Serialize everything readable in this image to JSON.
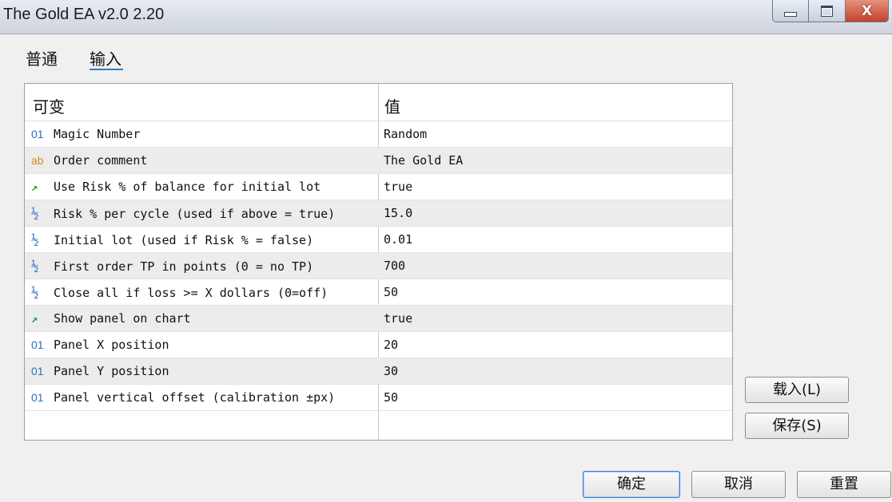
{
  "window": {
    "title": "The Gold EA v2.0 2.20",
    "controls": {
      "minimize": "_",
      "maximize": "□",
      "close": "X"
    }
  },
  "tabs": [
    {
      "label": "普通"
    },
    {
      "label": "输入",
      "active": true
    }
  ],
  "table": {
    "headers": {
      "name": "可变",
      "value": "值"
    },
    "rows": [
      {
        "icon": "01",
        "icon_type": "int-icon",
        "name": "Magic Number",
        "value": "Random"
      },
      {
        "icon": "ab",
        "icon_type": "string-icon",
        "name": "Order comment",
        "value": "The Gold EA"
      },
      {
        "icon": "↗",
        "icon_type": "bool-icon",
        "name": "Use Risk % of balance for initial lot",
        "value": "true"
      },
      {
        "icon": "½",
        "icon_type": "double-icon",
        "name": "Risk % per cycle (used if above = true)",
        "value": "15.0"
      },
      {
        "icon": "½",
        "icon_type": "double-icon",
        "name": "Initial lot (used if Risk % = false)",
        "value": "0.01"
      },
      {
        "icon": "½",
        "icon_type": "double-icon",
        "name": "First order TP in points (0 = no TP)",
        "value": "700"
      },
      {
        "icon": "½",
        "icon_type": "double-icon",
        "name": "Close all if loss >= X dollars (0=off)",
        "value": "50"
      },
      {
        "icon": "↗",
        "icon_type": "bool-icon",
        "name": "Show panel on chart",
        "value": "true"
      },
      {
        "icon": "01",
        "icon_type": "int-icon",
        "name": "Panel X position",
        "value": "20"
      },
      {
        "icon": "01",
        "icon_type": "int-icon",
        "name": "Panel Y position",
        "value": "30"
      },
      {
        "icon": "01",
        "icon_type": "int-icon",
        "name": "Panel vertical offset (calibration ±px)",
        "value": "50"
      }
    ]
  },
  "side_buttons": {
    "load": "载入(L)",
    "save": "保存(S)"
  },
  "footer_buttons": {
    "ok": "确定",
    "cancel": "取消",
    "reset": "重置"
  },
  "colors": {
    "int_icon": "#2a6fc0",
    "string_icon": "#d98a1a",
    "bool_icon": "#2aa33c",
    "ok_border": "#3c7fcf"
  }
}
